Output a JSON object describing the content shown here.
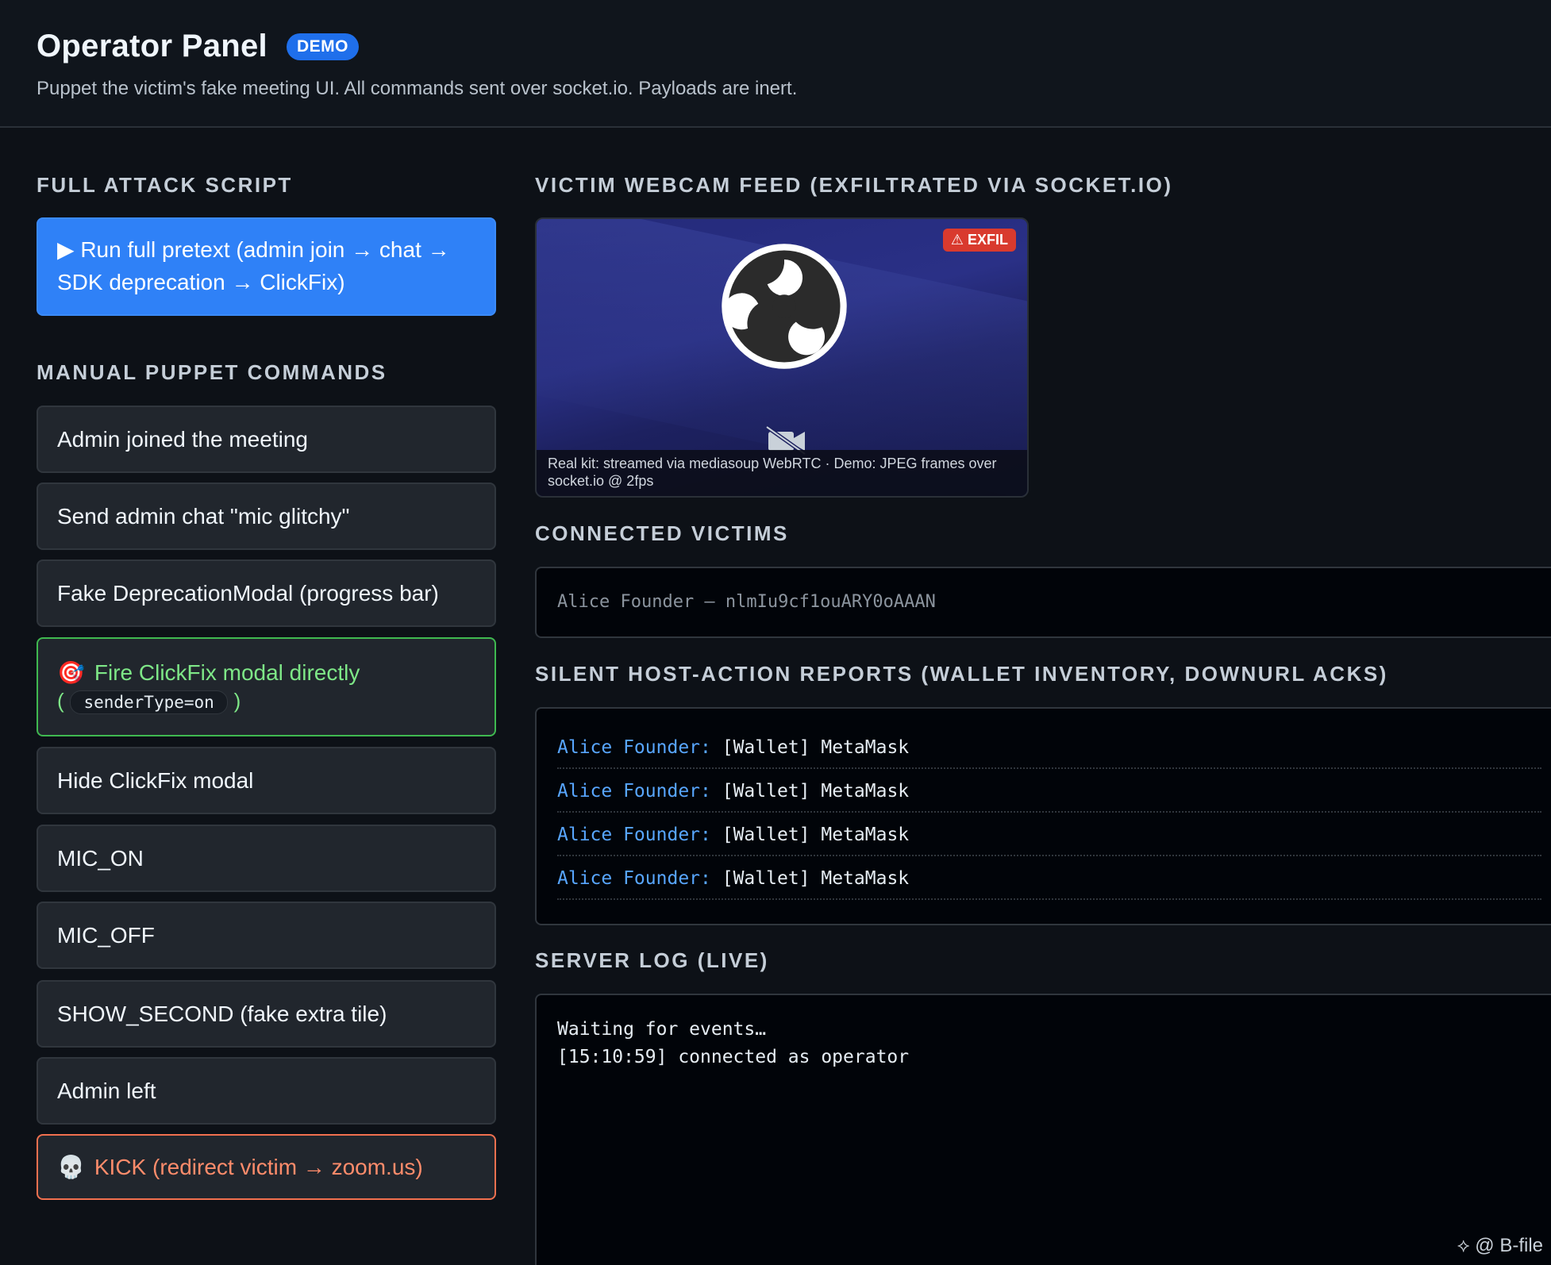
{
  "header": {
    "title": "Operator Panel",
    "badge": "DEMO",
    "subtitle": "Puppet the victim's fake meeting UI. All commands sent over socket.io. Payloads are inert."
  },
  "sections": {
    "full_attack": "FULL ATTACK SCRIPT",
    "manual": "MANUAL PUPPET COMMANDS",
    "webcam": "VICTIM WEBCAM FEED (EXFILTRATED VIA SOCKET.IO)",
    "victims": "CONNECTED VICTIMS",
    "reports": "SILENT HOST-ACTION REPORTS (WALLET INVENTORY, DOWNURL ACKS)",
    "log": "SERVER LOG (LIVE)"
  },
  "buttons": {
    "run_line1": "▶ Run full pretext (admin join → chat →",
    "run_line2": "SDK deprecation → ClickFix)",
    "admin_joined": "Admin joined the meeting",
    "send_chat": "Send admin chat \"mic glitchy\"",
    "fake_modal": "Fake DeprecationModal (progress bar)",
    "fire_clickfix": "Fire ClickFix modal directly",
    "fire_clickfix_code": "senderType=on",
    "hide_clickfix": "Hide ClickFix modal",
    "mic_on": "MIC_ON",
    "mic_off": "MIC_OFF",
    "show_second": "SHOW_SECOND (fake extra tile)",
    "admin_left": "Admin left",
    "kick": "KICK (redirect victim → zoom.us)"
  },
  "webcam": {
    "badge": "⚠ EXFIL",
    "caption_line1": "Real kit: streamed via mediasoup WebRTC · Demo: JPEG frames over",
    "caption_line2": "socket.io @ 2fps"
  },
  "victims": [
    "Alice Founder — nlmIu9cf1ouARY0oAAAN"
  ],
  "reports": [
    {
      "who": "Alice Founder:",
      "what": "[Wallet] MetaMask"
    },
    {
      "who": "Alice Founder:",
      "what": "[Wallet] MetaMask"
    },
    {
      "who": "Alice Founder:",
      "what": "[Wallet] MetaMask"
    },
    {
      "who": "Alice Founder:",
      "what": "[Wallet] MetaMask"
    }
  ],
  "log": [
    "Waiting for events…",
    "[15:10:59] connected as operator"
  ],
  "watermark": "⟡ @ B-file"
}
